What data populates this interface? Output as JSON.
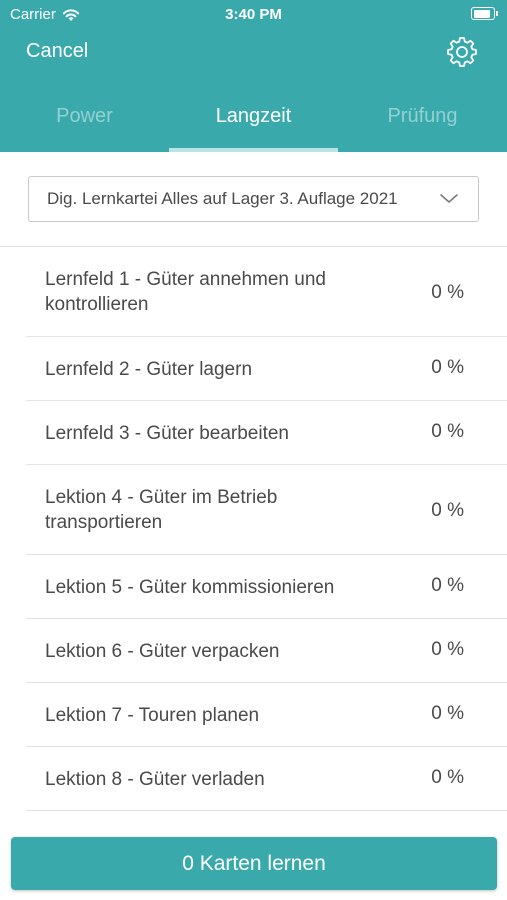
{
  "status_bar": {
    "carrier": "Carrier",
    "time": "3:40 PM",
    "wifi_icon": "wifi-icon",
    "battery_icon": "battery-icon"
  },
  "nav": {
    "cancel_label": "Cancel",
    "settings_icon": "gear-icon"
  },
  "tabs": [
    {
      "label": "Power",
      "active": false
    },
    {
      "label": "Langzeit",
      "active": true
    },
    {
      "label": "Prüfung",
      "active": false
    }
  ],
  "selector": {
    "value": "Dig. Lernkartei Alles auf Lager 3. Auflage 2021",
    "icon": "chevron-down-icon"
  },
  "items": [
    {
      "label": "Lernfeld 1 - Güter annehmen und kontrollieren",
      "percent": "0 %"
    },
    {
      "label": "Lernfeld 2 - Güter lagern",
      "percent": "0 %"
    },
    {
      "label": "Lernfeld 3 - Güter bearbeiten",
      "percent": "0 %"
    },
    {
      "label": "Lektion 4 - Güter im Betrieb transportieren",
      "percent": "0 %"
    },
    {
      "label": "Lektion 5 - Güter kommissionieren",
      "percent": "0 %"
    },
    {
      "label": "Lektion 6 - Güter verpacken",
      "percent": "0 %"
    },
    {
      "label": "Lektion 7 - Touren planen",
      "percent": "0 %"
    },
    {
      "label": "Lektion 8 - Güter verladen",
      "percent": "0 %"
    }
  ],
  "footer": {
    "button_label": "0 Karten lernen"
  },
  "colors": {
    "accent": "#39a9ac",
    "tab_indicator": "#b9e4e5",
    "text": "#4a4a4a",
    "separator": "#e3e3e3"
  }
}
